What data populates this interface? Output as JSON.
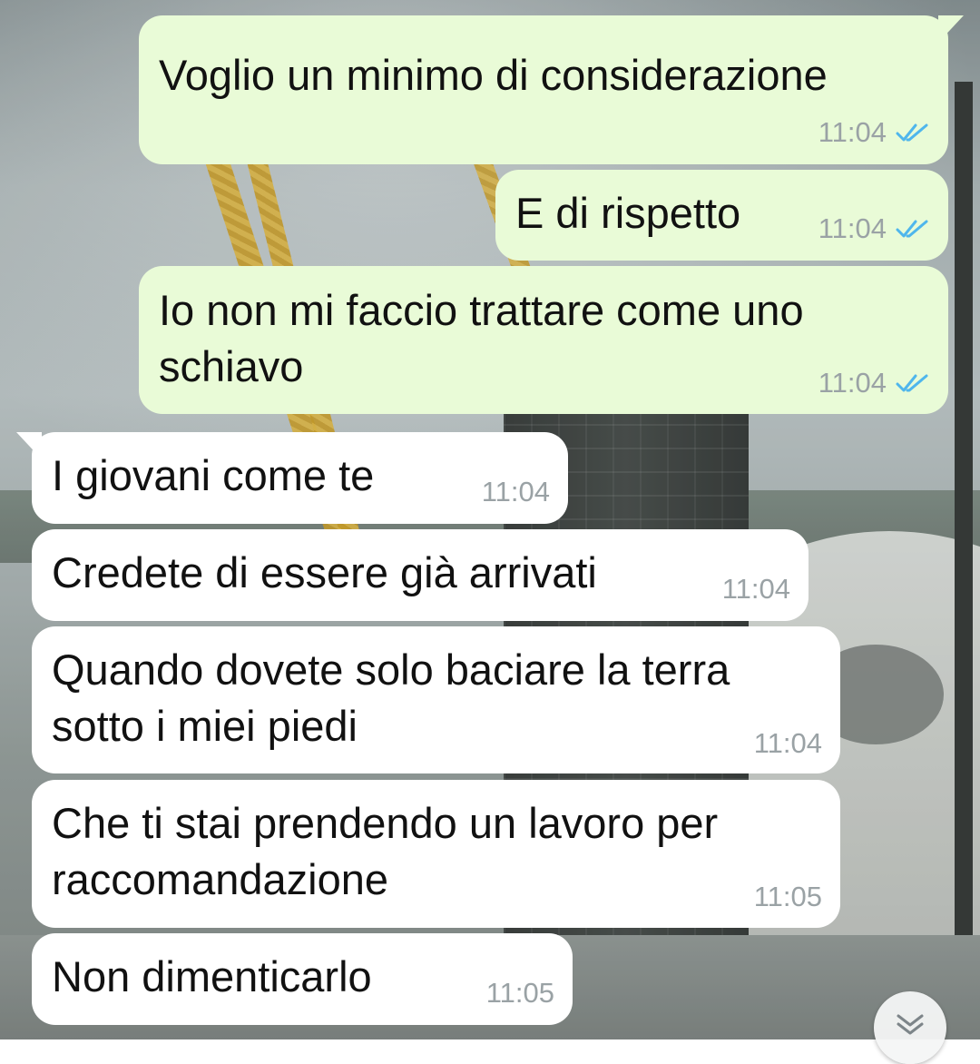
{
  "chat": {
    "messages": [
      {
        "direction": "outgoing",
        "lines": [
          "Voglio un minimo di considerazione"
        ],
        "time": "11:04",
        "status": "read"
      },
      {
        "direction": "outgoing",
        "lines": [
          "E di rispetto"
        ],
        "time": "11:04",
        "status": "read"
      },
      {
        "direction": "outgoing",
        "lines": [
          "Io non mi faccio trattare come uno",
          "schiavo"
        ],
        "time": "11:04",
        "status": "read"
      },
      {
        "direction": "incoming",
        "lines": [
          "I giovani come te"
        ],
        "time": "11:04"
      },
      {
        "direction": "incoming",
        "lines": [
          "Credete di essere già arrivati"
        ],
        "time": "11:04"
      },
      {
        "direction": "incoming",
        "lines": [
          "Quando dovete solo baciare la terra",
          "sotto i miei piedi"
        ],
        "time": "11:04"
      },
      {
        "direction": "incoming",
        "lines": [
          "Che ti stai prendendo un lavoro per",
          "raccomandazione"
        ],
        "time": "11:05"
      },
      {
        "direction": "incoming",
        "lines": [
          "Non dimenticarlo"
        ],
        "time": "11:05"
      }
    ]
  },
  "icons": {
    "read_receipt": "double-check-icon",
    "scroll_down": "chevron-double-down-icon"
  },
  "colors": {
    "outgoing_bubble": "#e9fbd7",
    "incoming_bubble": "#ffffff",
    "timestamp": "#9aa2a5",
    "read_tick": "#4fb6ec"
  }
}
